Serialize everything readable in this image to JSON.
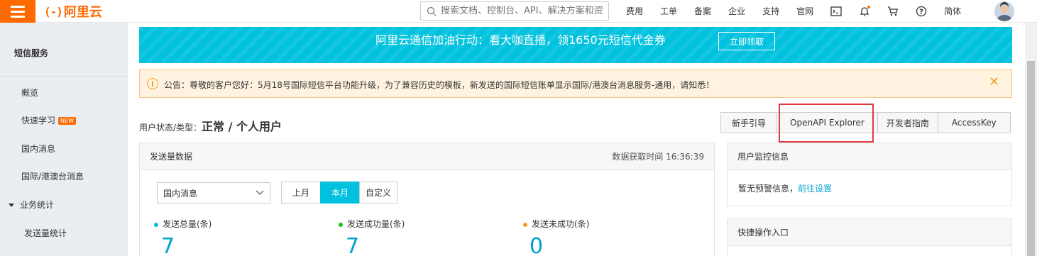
{
  "header": {
    "logo_text": "阿里云",
    "search_placeholder": "搜索文档、控制台、API、解决方案和资源",
    "nav_links": [
      "费用",
      "工单",
      "备案",
      "企业",
      "支持",
      "官网"
    ],
    "lang": "简体",
    "icons": [
      "terminal-icon",
      "bell-icon",
      "cart-icon",
      "help-icon"
    ]
  },
  "sidebar": {
    "title": "短信服务",
    "items": [
      {
        "label": "概览"
      },
      {
        "label": "快速学习",
        "badge": "NEW"
      },
      {
        "label": "国内消息"
      },
      {
        "label": "国际/港澳台消息"
      }
    ],
    "group": {
      "label": "业务统计",
      "children": [
        "发送量统计"
      ]
    }
  },
  "banner": {
    "text": "阿里云通信加油行动：看大咖直播，领1650元短信代金券",
    "button": "立即领取",
    "color": "#00c1de"
  },
  "notice": {
    "text": "公告：尊敬的客户您好：5月18号国际短信平台功能升级，为了兼容历史的模板，新发送的国际短信账单显示国际/港澳台消息服务-通用，请知悉！"
  },
  "user_status": {
    "label": "用户状态/类型：",
    "value": "正常 / 个人用户"
  },
  "action_buttons": [
    "新手引导",
    "OpenAPI Explorer",
    "开发者指南",
    "AccessKey"
  ],
  "send_panel": {
    "title": "发送量数据",
    "fetch_time_label": "数据获取时间 16:36:39",
    "select_value": "国内消息",
    "periods": [
      {
        "label": "上月",
        "active": false
      },
      {
        "label": "本月",
        "active": true
      },
      {
        "label": "自定义",
        "active": false
      }
    ],
    "stats": [
      {
        "label": "发送总量(条)",
        "value": "7",
        "color": "#00c1de"
      },
      {
        "label": "发送成功量(条)",
        "value": "7",
        "color": "#1dc11d"
      },
      {
        "label": "发送未成功(条)",
        "value": "0",
        "color": "#f0a020"
      }
    ]
  },
  "monitor_panel": {
    "title": "用户监控信息",
    "text": "暂无预警信息，",
    "link": "前往设置"
  },
  "quick_panel": {
    "title": "快捷操作入口"
  }
}
